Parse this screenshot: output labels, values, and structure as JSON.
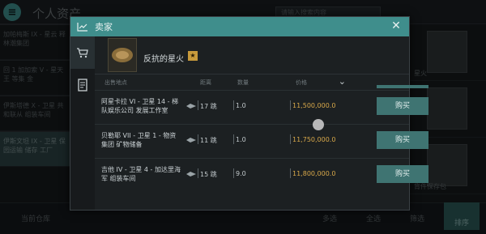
{
  "app": {
    "title": "个人资产",
    "search_placeholder": "请输入搜索内容",
    "left_rows": [
      {
        "text": "加帕梅斯 IX - 星云 释林潮集团"
      },
      {
        "text": "回 1 加加索 V - 星天王 等集 金"
      },
      {
        "text": "伊斯塔德 X - 卫星 共和联从 组装车间"
      },
      {
        "text": "伊斯文坦 IX - 卫星 保园运输 储存 工厂"
      }
    ],
    "right_labels": [
      "星火",
      "",
      "背件保存包"
    ],
    "bottom_items": [
      "当前仓库",
      "多选",
      "全选",
      "筛选"
    ],
    "sort_label": "排序"
  },
  "modal": {
    "title": "卖家",
    "close_symbol": "✕",
    "item_name": "反抗的星火",
    "star_glyph": "★",
    "columns": {
      "location": "出售地点",
      "jumps": "距离",
      "quantity": "数量",
      "price": "价格"
    },
    "rows": [
      {
        "location": "阿星卡拉 VI - 卫星 14 - 梯队娱乐公司 发展工作室",
        "jumps": "17 跳",
        "quantity": "1.0",
        "price": "11,500,000.0",
        "buy": "购买"
      },
      {
        "location": "贝勒耶 VII - 卫星 1 - 物资集团 矿物储备",
        "jumps": "11 跳",
        "quantity": "1.0",
        "price": "11,750,000.0",
        "buy": "购买"
      },
      {
        "location": "吉他 IV - 卫星 4 - 加达里海军 组装车间",
        "jumps": "15 跳",
        "quantity": "9.0",
        "price": "11,800,000.0",
        "buy": "购买"
      }
    ]
  },
  "colors": {
    "accent": "#3f8e8c",
    "buy_button": "#3f7472",
    "price": "#d8a84a",
    "star": "#c79a3c"
  }
}
